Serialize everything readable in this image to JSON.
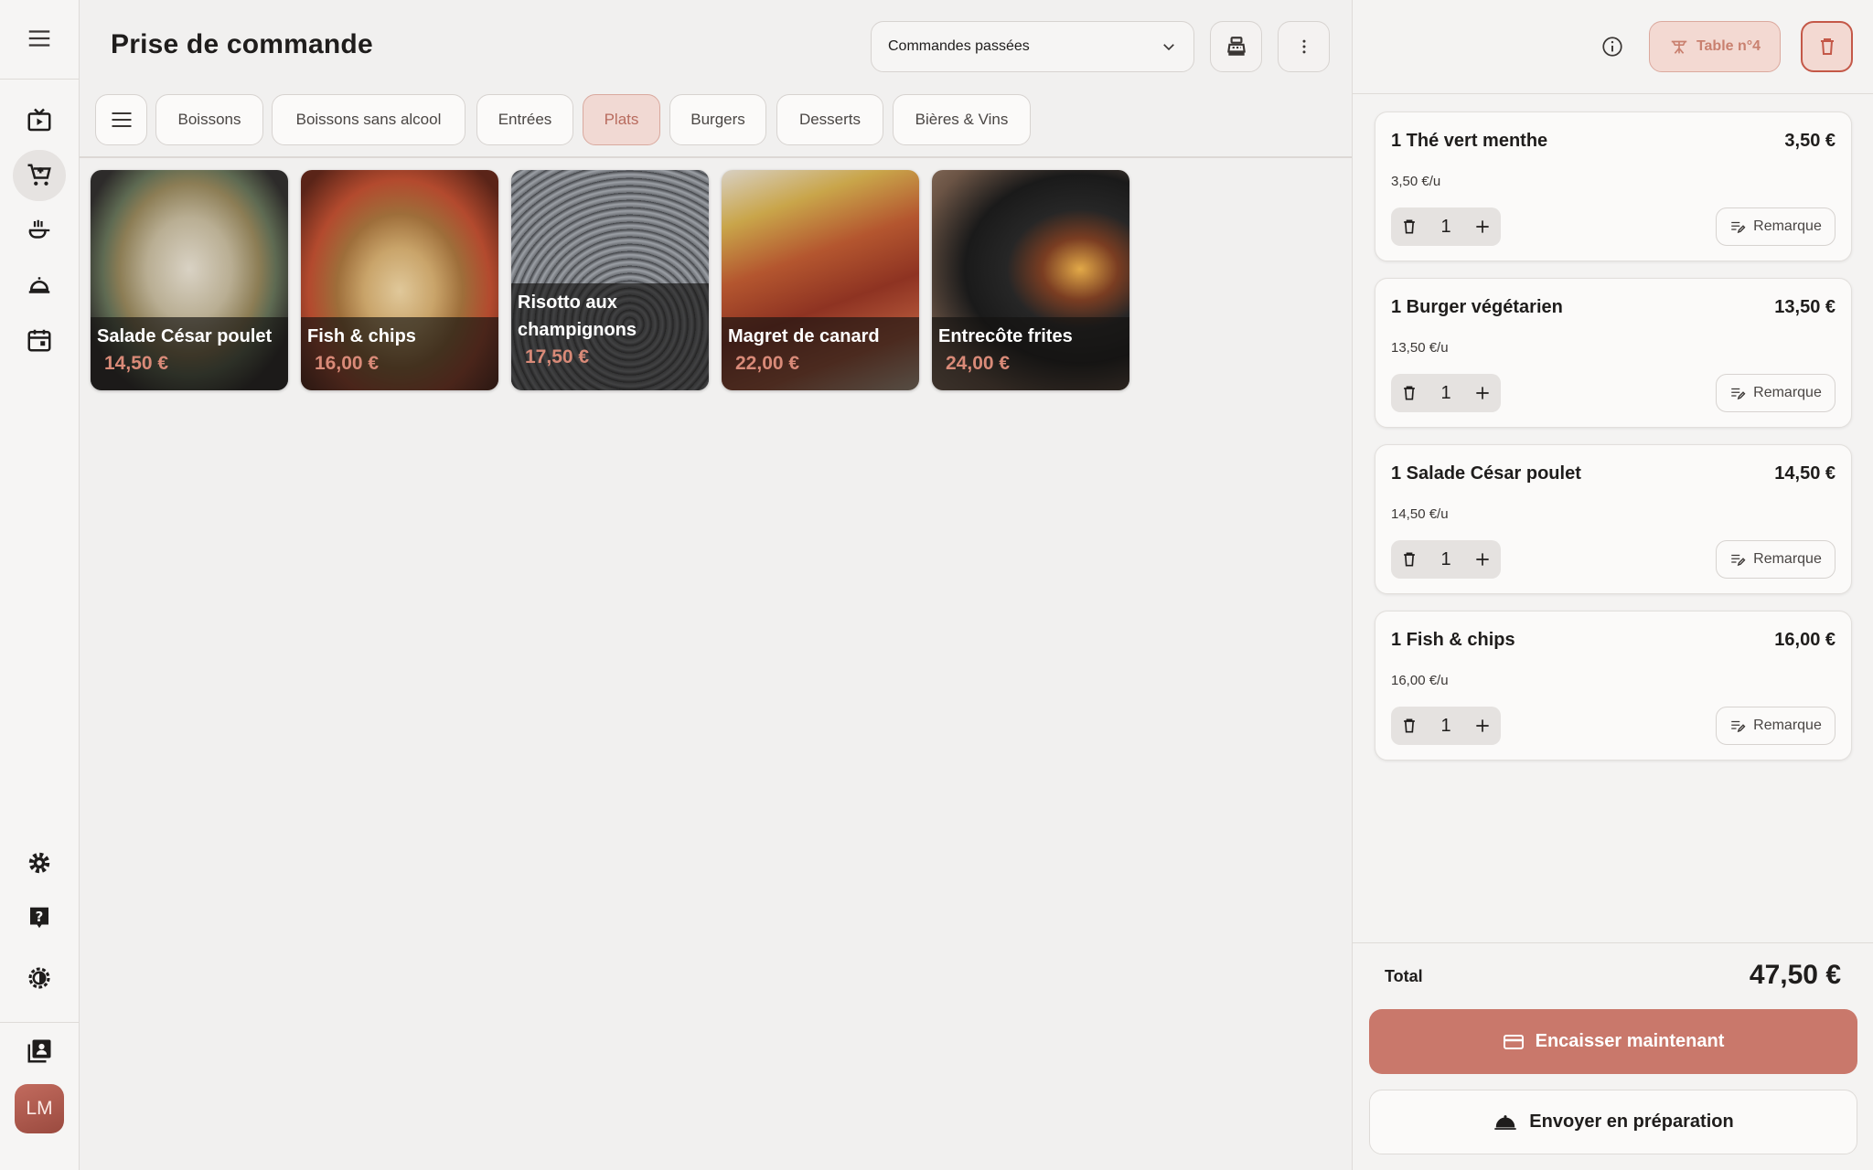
{
  "header": {
    "title": "Prise de commande",
    "orders_select": "Commandes passées",
    "select_icon": "chevron-down-icon",
    "register_icon": "cash-register-icon",
    "more_icon": "more-vertical-icon"
  },
  "rail": {
    "items": [
      "menu-icon",
      "display-icon",
      "add-to-cart-icon",
      "kitchen-icon",
      "cloche-icon",
      "calendar-icon",
      "settings-icon",
      "help-icon",
      "theme-icon",
      "orders-list-icon"
    ],
    "active": "add-to-cart-icon",
    "avatar": "LM"
  },
  "categories": {
    "menu_icon": "list-icon",
    "items": [
      {
        "label": "Boissons"
      },
      {
        "label": "Boissons sans alcool"
      },
      {
        "label": "Entrées"
      },
      {
        "label": "Plats"
      },
      {
        "label": "Burgers"
      },
      {
        "label": "Desserts"
      },
      {
        "label": "Bières & Vins"
      }
    ],
    "active": "Plats"
  },
  "products": [
    {
      "name": "Salade César poulet",
      "price": "14,50 €"
    },
    {
      "name": "Fish & chips",
      "price": "16,00 €"
    },
    {
      "name": "Risotto aux champignons",
      "price": "17,50 €"
    },
    {
      "name": "Magret de canard",
      "price": "22,00 €"
    },
    {
      "name": "Entrecôte frites",
      "price": "24,00 €"
    }
  ],
  "order": {
    "table_label": "Table n°4",
    "lines": [
      {
        "name": "1 Thé vert menthe",
        "total": "3,50 €",
        "unit": "3,50 €/u",
        "qty": "1",
        "remark": "Remarque"
      },
      {
        "name": "1 Burger végétarien",
        "total": "13,50 €",
        "unit": "13,50 €/u",
        "qty": "1",
        "remark": "Remarque"
      },
      {
        "name": "1 Salade César poulet",
        "total": "14,50 €",
        "unit": "14,50 €/u",
        "qty": "1",
        "remark": "Remarque"
      },
      {
        "name": "1 Fish & chips",
        "total": "16,00 €",
        "unit": "16,00 €/u",
        "qty": "1",
        "remark": "Remarque"
      }
    ],
    "total_label": "Total",
    "total_value": "47,50 €",
    "pay_label": "Encaisser maintenant",
    "send_label": "Envoyer en préparation"
  },
  "colors": {
    "accent": "#c9786b",
    "accent_light": "#f3d9d2",
    "background": "#f1f0ef"
  }
}
